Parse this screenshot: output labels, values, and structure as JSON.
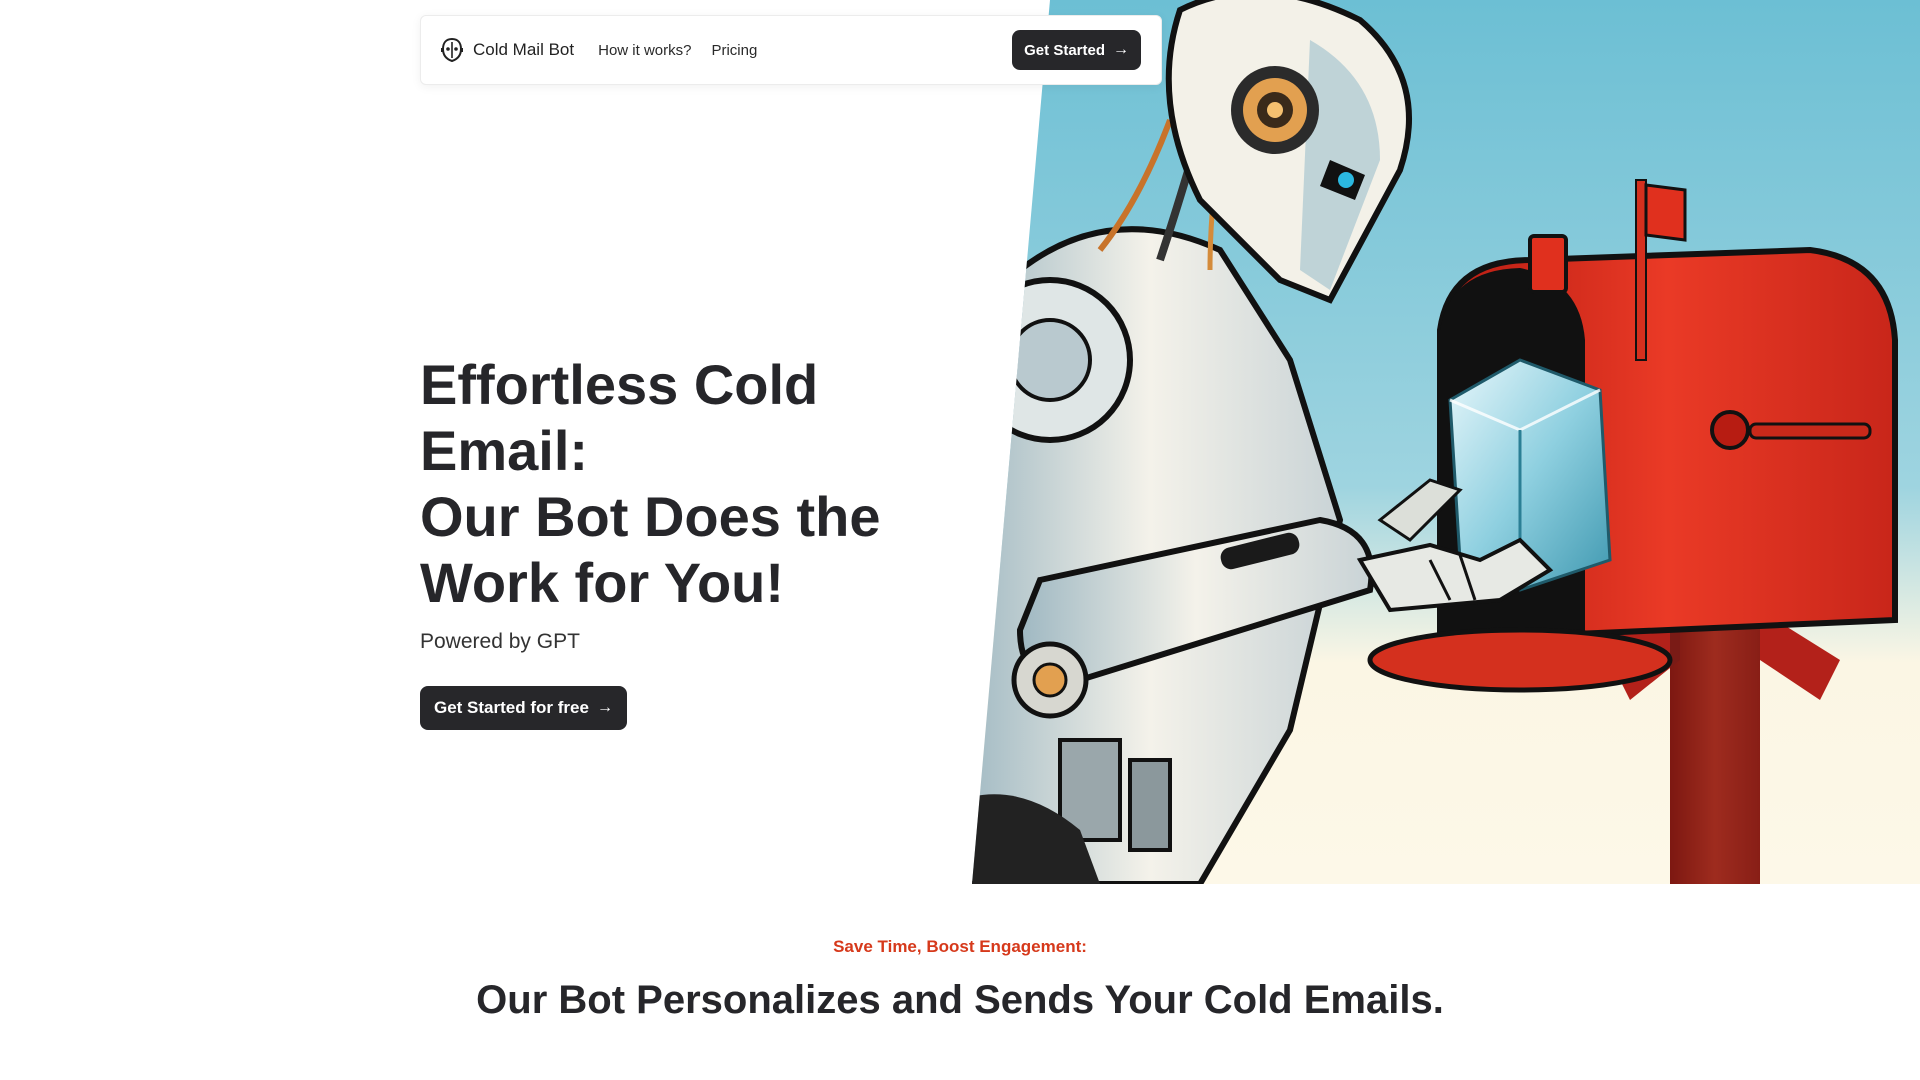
{
  "nav": {
    "brand": "Cold Mail Bot",
    "links": [
      "How it works?",
      "Pricing"
    ],
    "cta": "Get Started",
    "brand_icon": "robot-head-icon",
    "cta_icon": "arrow-right-icon"
  },
  "hero": {
    "title_line1": "Effortless Cold",
    "title_line2": "Email:",
    "title_line3": "Our Bot Does the",
    "title_line4": "Work for You!",
    "subtitle": "Powered by GPT",
    "cta": "Get Started for free",
    "image": "robot-mailbox-illustration"
  },
  "section": {
    "eyebrow": "Save Time, Boost Engagement:",
    "title": "Our Bot Personalizes and Sends Your Cold Emails."
  },
  "colors": {
    "primary_button": "#27272a",
    "accent": "#d6391b",
    "sky": "#7fc4d6",
    "mailbox_red": "#e0301e"
  }
}
